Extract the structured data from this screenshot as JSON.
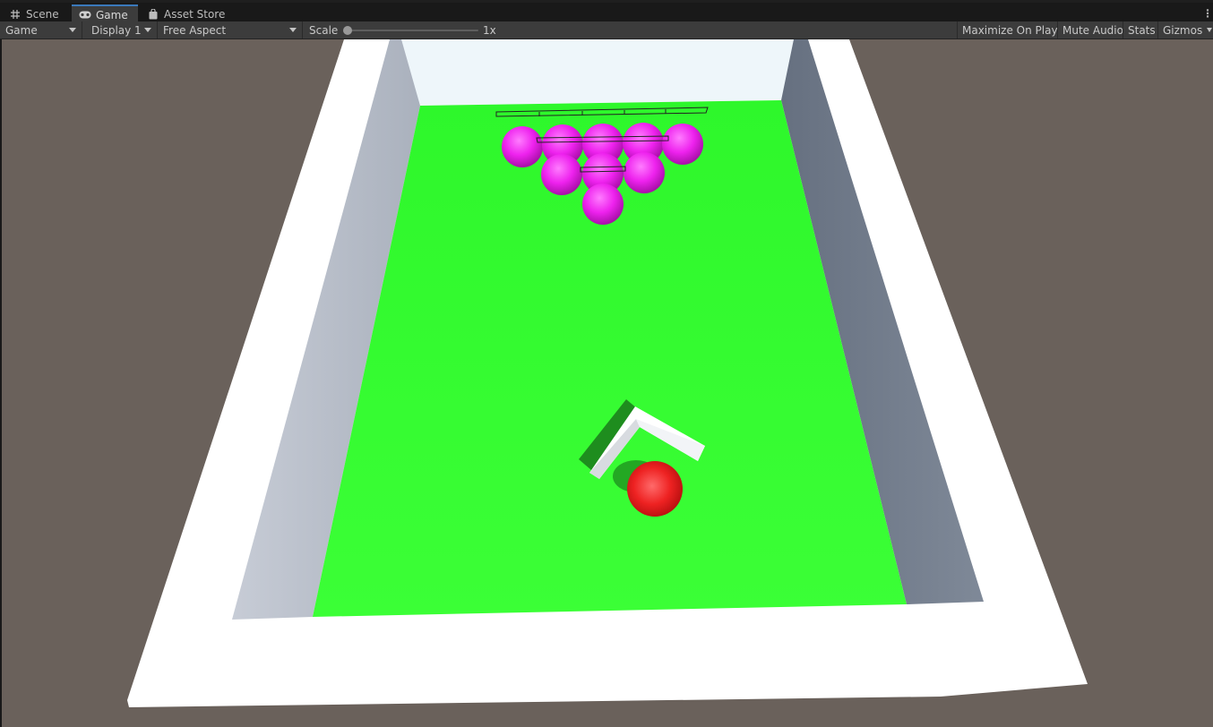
{
  "tabs": [
    {
      "label": "Scene",
      "icon": "grid-icon",
      "active": false
    },
    {
      "label": "Game",
      "icon": "gamepad-icon",
      "active": true
    },
    {
      "label": "Asset Store",
      "icon": "shopping-bag-icon",
      "active": false
    }
  ],
  "toolbar": {
    "view_dropdown": "Game",
    "display_dropdown": "Display 1",
    "aspect_dropdown": "Free Aspect",
    "scale_label": "Scale",
    "scale_value_label": "1x",
    "scale_value": 1,
    "maximize_label": "Maximize On Play",
    "mute_label": "Mute Audio",
    "stats_label": "Stats",
    "gizmos_label": "Gizmos"
  },
  "scene": {
    "background_color": "#6a615b",
    "table_color": "#33ff2e",
    "rail_color": "#ffffff",
    "target_ball_color": "#ee22ee",
    "target_ball_count": 9,
    "cue_ball_color": "#ee2222",
    "cue_ball_count": 1
  }
}
